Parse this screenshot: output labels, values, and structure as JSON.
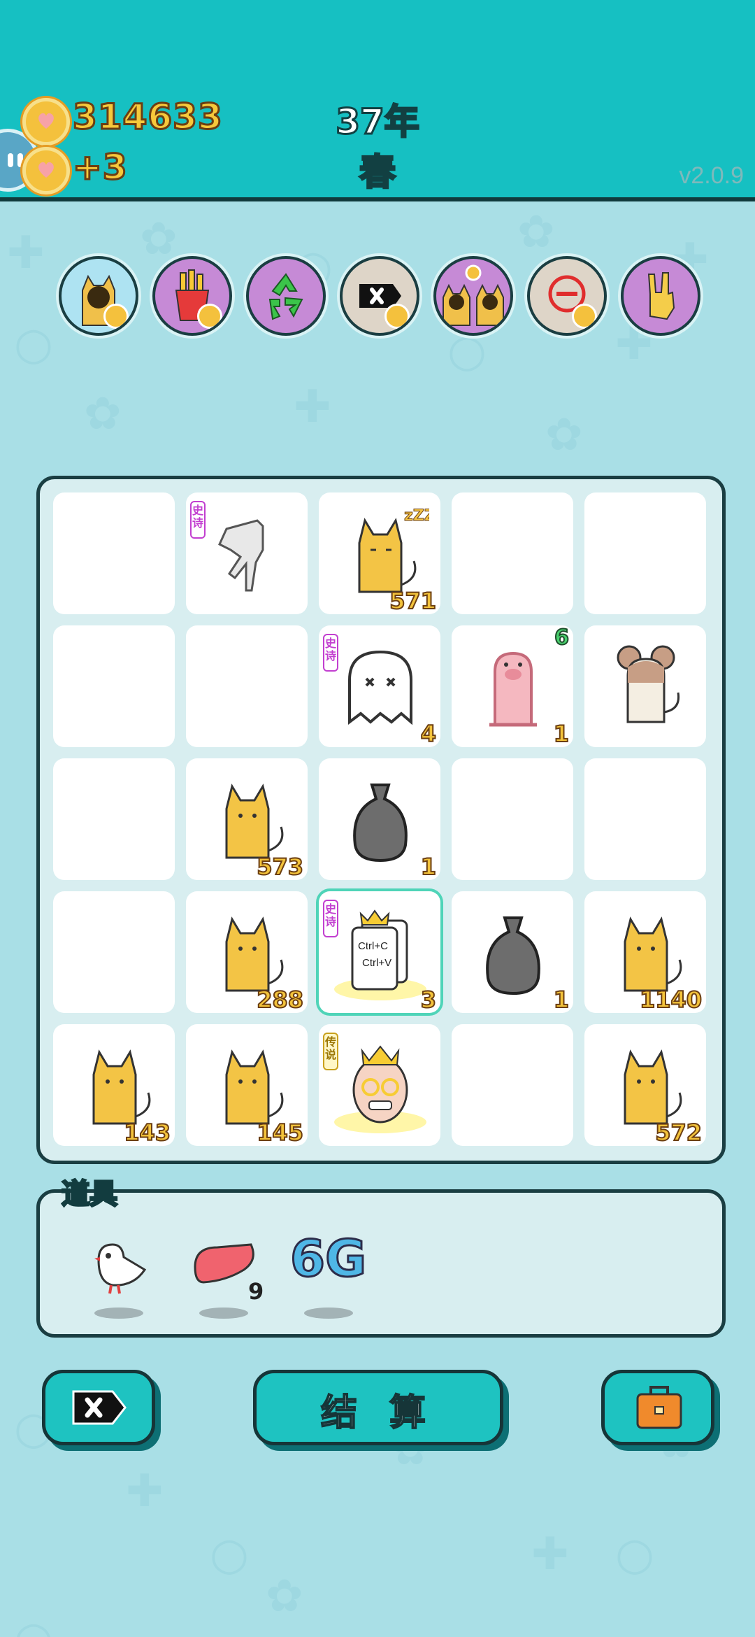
{
  "header": {
    "coins": "314633",
    "income": "+3",
    "year": "37年",
    "season": "春",
    "version": "v2.0.9"
  },
  "perks": [
    {
      "name": "cat-portrait"
    },
    {
      "name": "french-fries"
    },
    {
      "name": "recycle"
    },
    {
      "name": "remove-tag"
    },
    {
      "name": "twin-cats"
    },
    {
      "name": "minus-circle"
    },
    {
      "name": "rock-hand"
    }
  ],
  "board": {
    "rows": [
      [
        {
          "item": "",
          "count": ""
        },
        {
          "item": "pointing-hand",
          "count": "",
          "tag": "史诗"
        },
        {
          "item": "sleeping-cat",
          "count": "571"
        },
        {
          "item": "",
          "count": ""
        },
        {
          "item": "",
          "count": ""
        }
      ],
      [
        {
          "item": "",
          "count": ""
        },
        {
          "item": "",
          "count": ""
        },
        {
          "item": "ghost",
          "count": "4",
          "tag": "史诗"
        },
        {
          "item": "pig",
          "count": "1",
          "top_count": "6"
        },
        {
          "item": "mouse",
          "count": ""
        }
      ],
      [
        {
          "item": "",
          "count": ""
        },
        {
          "item": "cat",
          "count": "573"
        },
        {
          "item": "trash-bag",
          "count": "1"
        },
        {
          "item": "",
          "count": ""
        },
        {
          "item": "",
          "count": ""
        }
      ],
      [
        {
          "item": "",
          "count": ""
        },
        {
          "item": "cat",
          "count": "288"
        },
        {
          "item": "copy-paste",
          "count": "3",
          "tag": "史诗",
          "text1": "Ctrl+C",
          "text2": "Ctrl+V"
        },
        {
          "item": "trash-bag",
          "count": "1"
        },
        {
          "item": "cat",
          "count": "1140"
        }
      ],
      [
        {
          "item": "cat",
          "count": "143"
        },
        {
          "item": "cat",
          "count": "145"
        },
        {
          "item": "king",
          "count": "",
          "tag": "传说"
        },
        {
          "item": "",
          "count": ""
        },
        {
          "item": "cat",
          "count": "572"
        }
      ]
    ]
  },
  "props": {
    "label": "道具",
    "items": [
      {
        "name": "dove",
        "count": ""
      },
      {
        "name": "liver",
        "count": "9"
      },
      {
        "name": "6g",
        "count": "",
        "text": "6G"
      }
    ]
  },
  "buttons": {
    "settle_label": "结 算"
  },
  "colors": {
    "topbar": "#16c0c2",
    "background": "#a9dfe6",
    "count_gold": "#f3c33b",
    "button": "#1ec3c1"
  }
}
